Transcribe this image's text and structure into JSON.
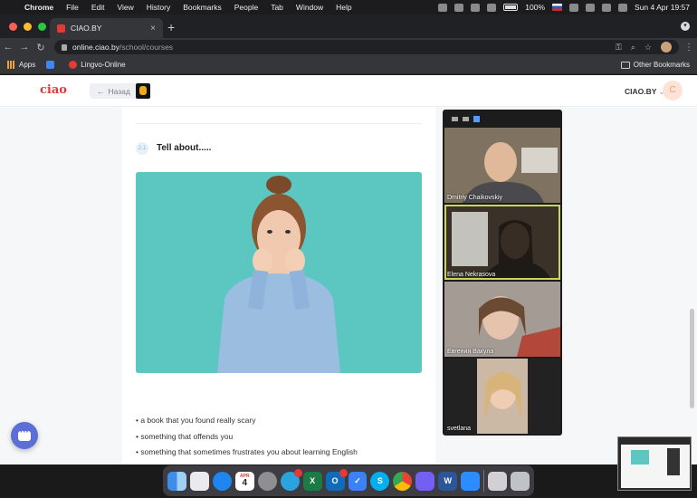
{
  "menubar": {
    "app_name": "Chrome",
    "items": [
      "File",
      "Edit",
      "View",
      "History",
      "Bookmarks",
      "People",
      "Tab",
      "Window",
      "Help"
    ],
    "battery": "100%",
    "datetime": "Sun 4 Apr  19:57"
  },
  "browser": {
    "tab_title": "CIAO.BY",
    "url_host": "online.ciao.by",
    "url_path": "/school/courses",
    "bookmarks": [
      "Apps",
      "Lingvo-Online"
    ],
    "other_bookmarks": "Other Bookmarks"
  },
  "site": {
    "logo": "ciao",
    "back_label": "Назад",
    "brand": "CIAO.BY",
    "avatar_letter": "C"
  },
  "task": {
    "number": "2.1",
    "title": "Tell about.....",
    "bullets": [
      "• a book that you found really scary",
      "• something that offends you",
      "• something that sometimes frustrates you about learning English"
    ]
  },
  "zoom": {
    "participants": [
      {
        "name": "Dmitriy Chaikovskiy",
        "bg": "#8a7a60"
      },
      {
        "name": "Elena Nekrasova",
        "bg": "#3a3228"
      },
      {
        "name": "Евгения Вакула",
        "bg": "#9a8c86"
      },
      {
        "name": "svetlana",
        "bg": "#c9b7a4"
      }
    ]
  },
  "dock": {
    "calendar_month": "APR",
    "calendar_day": "4",
    "apps": [
      "finder-icon",
      "launchpad-icon",
      "safari-icon",
      "calendar-icon",
      "settings-icon",
      "telegram-icon",
      "excel-icon",
      "outlook-icon",
      "tasks-icon",
      "skype-icon",
      "chrome-icon",
      "viber-icon",
      "word-icon",
      "zoom-icon",
      "preview-icon",
      "trash-icon"
    ]
  },
  "colors": {
    "accent": "#5b6fd6",
    "logo_red": "#e53935",
    "photo_teal": "#5cc6c0",
    "active_speaker": "#c8d65e"
  }
}
